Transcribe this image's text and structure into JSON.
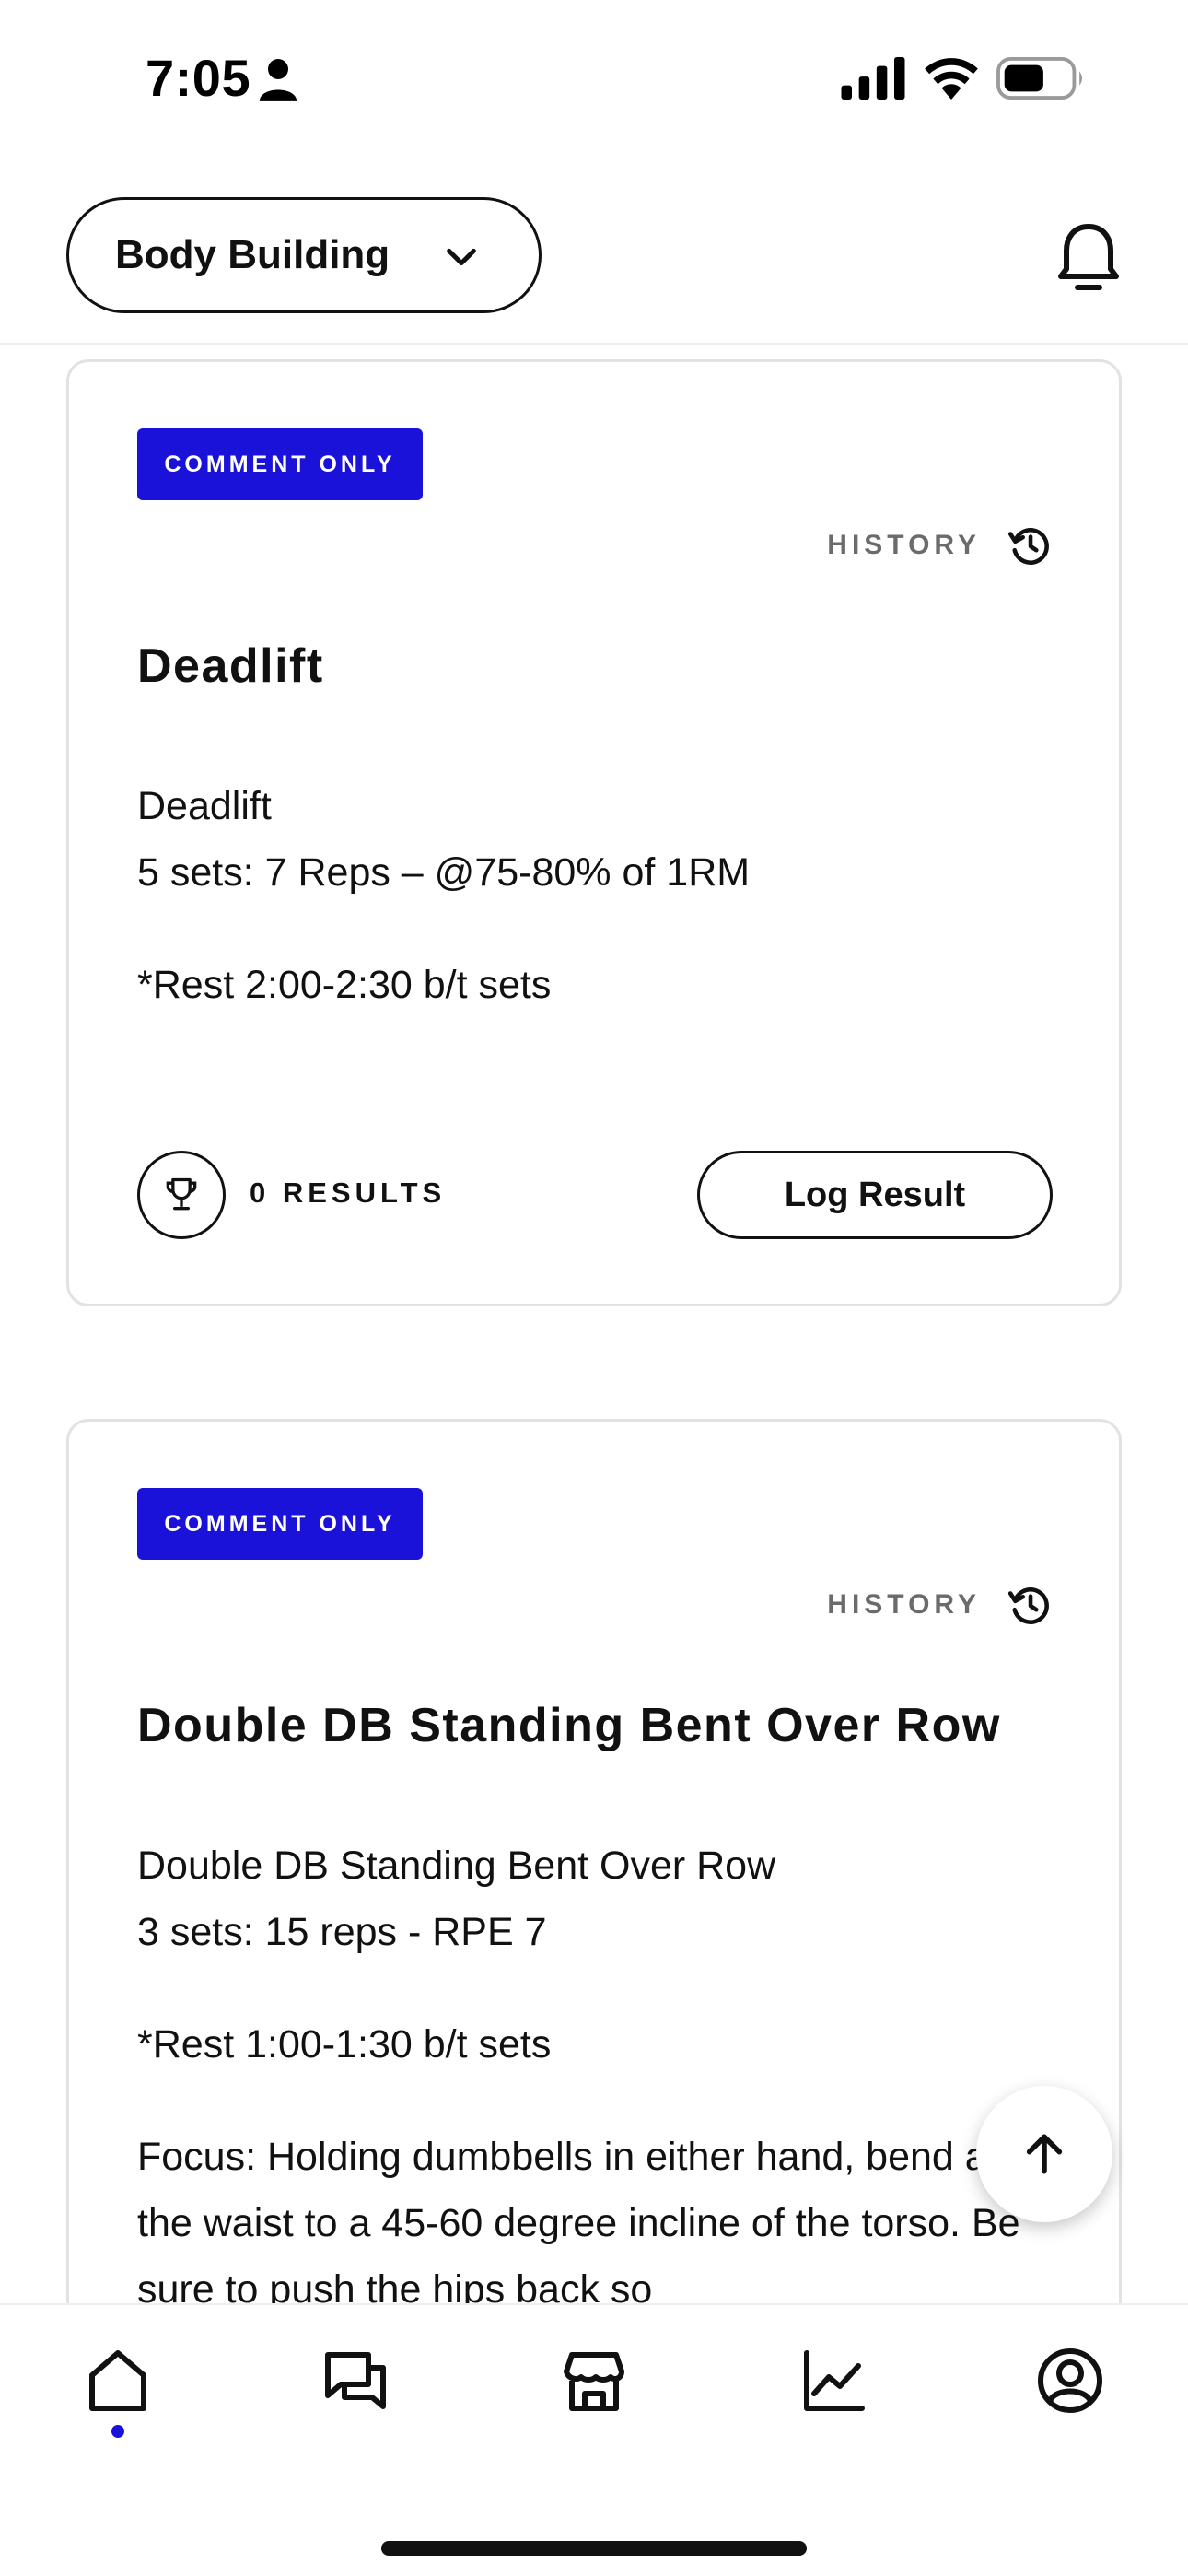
{
  "status_bar": {
    "time": "7:05"
  },
  "header": {
    "program_select_label": "Body Building",
    "notifications_icon": "bell-icon"
  },
  "cards": [
    {
      "badge": "COMMENT ONLY",
      "history_label": "HISTORY",
      "title": "Deadlift",
      "body_lines": [
        "Deadlift",
        "5 sets: 7 Reps – @75-80% of 1RM"
      ],
      "rest": "*Rest 2:00-2:30 b/t sets",
      "results": "0 RESULTS",
      "log_button": "Log Result"
    },
    {
      "badge": "COMMENT ONLY",
      "history_label": "HISTORY",
      "title": "Double DB Standing Bent Over Row",
      "body_lines": [
        "Double DB Standing Bent Over Row",
        "3 sets: 15 reps - RPE 7"
      ],
      "rest": "*Rest 1:00-1:30 b/t sets",
      "focus": "Focus: Holding dumbbells in either hand, bend at the waist to a 45-60 degree incline of the torso. Be sure to push the hips back so"
    }
  ],
  "bottom_nav": {
    "items": [
      "home-icon",
      "chat-icon",
      "store-icon",
      "chart-icon",
      "profile-icon"
    ],
    "active": "home-icon"
  },
  "colors": {
    "accent": "#1b12d9",
    "text": "#111111",
    "muted": "#6b6b6b",
    "border": "#e2e2e2"
  }
}
